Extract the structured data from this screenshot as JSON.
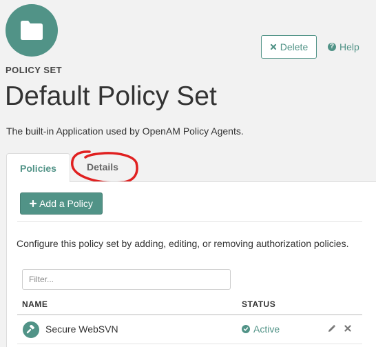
{
  "header": {
    "avatar_icon": "folder-icon",
    "kicker": "POLICY SET",
    "title": "Default Policy Set",
    "subtitle": "The built-in Application used by OpenAM Policy Agents.",
    "delete_label": "Delete",
    "help_label": "Help"
  },
  "tabs": [
    {
      "label": "Policies",
      "active": true
    },
    {
      "label": "Details",
      "active": false
    }
  ],
  "policies_panel": {
    "add_button_label": "Add a Policy",
    "description": "Configure this policy set by adding, editing, or removing authorization policies.",
    "filter_placeholder": "Filter...",
    "columns": [
      "NAME",
      "STATUS"
    ],
    "rows": [
      {
        "name": "Secure WebSVN",
        "status": "Active",
        "icon": "policy-icon"
      }
    ]
  },
  "colors": {
    "accent": "#519387",
    "annotation": "#e02020"
  }
}
